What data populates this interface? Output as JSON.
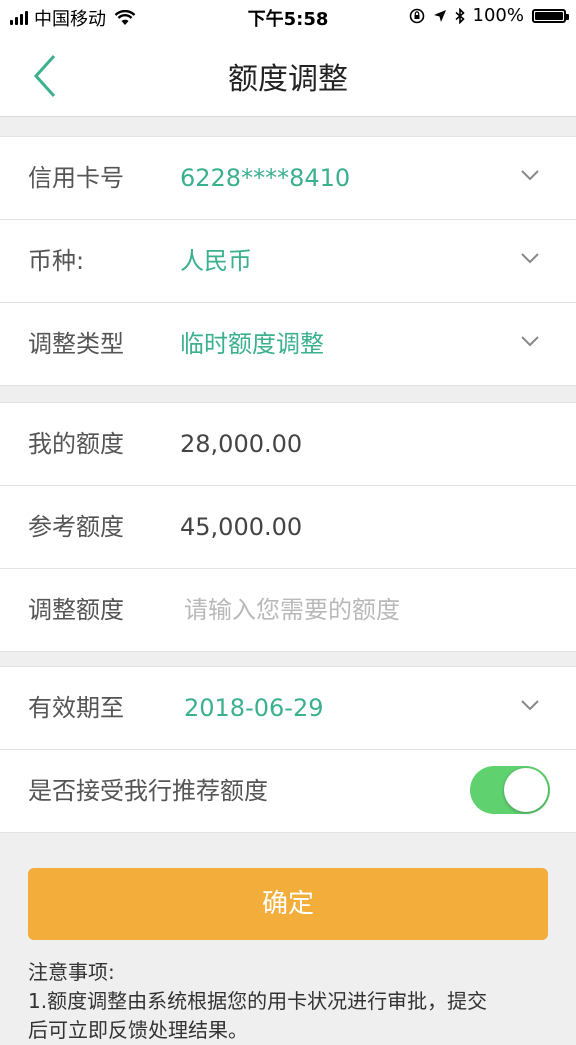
{
  "status_bar": {
    "carrier": "中国移动",
    "time": "下午5:58",
    "battery": "100%",
    "battery_level": 1.0
  },
  "nav": {
    "title": "额度调整",
    "back_icon": "chevron-left-icon"
  },
  "card_section": {
    "rows": [
      {
        "label": "信用卡号",
        "value": "6228****8410"
      },
      {
        "label": "币种:",
        "value": "人民币"
      },
      {
        "label": "调整类型",
        "value": "临时额度调整"
      }
    ]
  },
  "limit_section": {
    "rows": [
      {
        "label": "我的额度",
        "value": "28,000.00"
      },
      {
        "label": "参考额度",
        "value": "45,000.00"
      },
      {
        "label": "调整额度",
        "placeholder": "请输入您需要的额度"
      }
    ]
  },
  "validity_section": {
    "expiry_label": "有效期至",
    "expiry_value": "2018-06-29",
    "recommend_label": "是否接受我行推荐额度",
    "recommend_on": true
  },
  "confirm_label": "确定",
  "notes": {
    "title": "注意事项:",
    "line1": "1.额度调整由系统根据您的用卡状况进行审批，提交",
    "line2": "后可立即反馈处理结果。"
  },
  "colors": {
    "accent_green": "#3bb08f",
    "button_orange": "#f2ad3a",
    "toggle_green": "#5fd16f"
  }
}
